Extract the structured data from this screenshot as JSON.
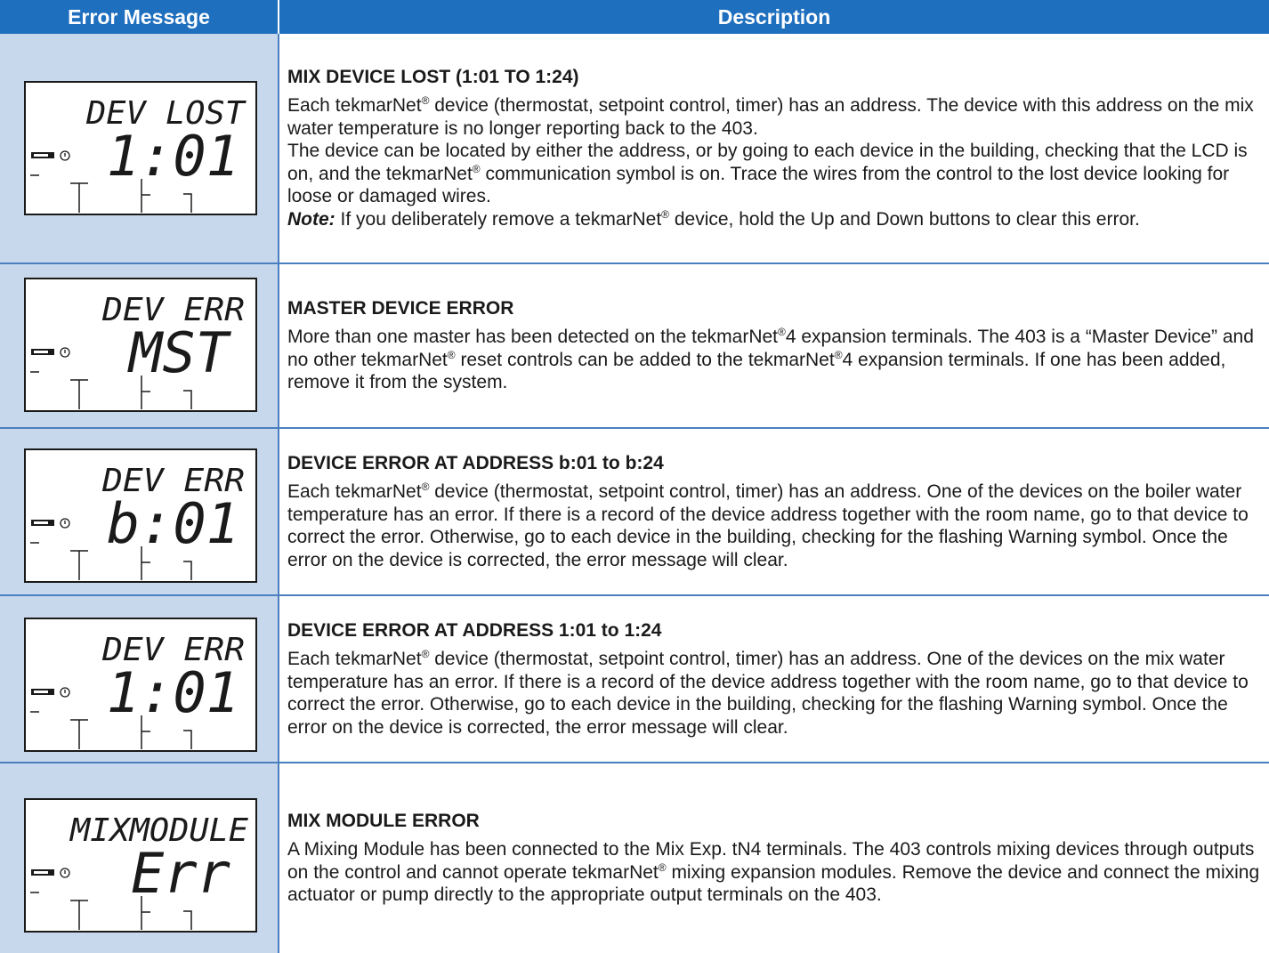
{
  "header": {
    "col1": "Error Message",
    "col2": "Description"
  },
  "colors": {
    "header_bg": "#1f6fbf",
    "lcd_cell_bg": "#c8d8ec",
    "border": "#4a7fbf"
  },
  "rows": [
    {
      "lcd": {
        "top_text": "DEV LOST",
        "main_text": "1:01",
        "icons": [
          "wrench-icon",
          "warning-icon"
        ]
      },
      "title": "MIX DEVICE LOST (1:01 TO 1:24)",
      "paragraphs": [
        "Each tekmarNet® device (thermostat, setpoint control, timer) has an address. The device with this address on the mix water temperature is no longer reporting back to the 403.",
        "The device can be located by either the address, or by going to each device in the building, checking that the LCD is on, and the tekmarNet® communication symbol is on. Trace the wires from the control to the lost device looking for loose or damaged wires."
      ],
      "note_label": "Note:",
      "note_text": " If you deliberately remove a tekmarNet® device, hold the Up and Down buttons to clear this error."
    },
    {
      "lcd": {
        "top_text": "DEV ERR",
        "main_text": "MST",
        "icons": [
          "wrench-icon",
          "warning-icon"
        ]
      },
      "title": "MASTER DEVICE ERROR",
      "paragraphs": [
        "More than one master has been detected on the tekmarNet®4 expansion terminals. The 403 is a “Master Device” and no other tekmarNet® reset controls can be added to the tekmarNet®4 expansion terminals. If one has been added, remove it from the system."
      ]
    },
    {
      "lcd": {
        "top_text": "DEV ERR",
        "main_text": "b:01",
        "icons": [
          "wrench-icon",
          "warning-icon"
        ]
      },
      "title": "DEVICE ERROR AT ADDRESS b:01 to b:24",
      "paragraphs": [
        "Each tekmarNet® device (thermostat, setpoint control, timer) has an address. One of the devices on the boiler water temperature has an error. If there is a record of the device address together with the room name, go to that device to correct the error. Otherwise, go to each device in the building, checking for the flashing Warning symbol. Once the error on the device is corrected, the error message will clear."
      ]
    },
    {
      "lcd": {
        "top_text": "DEV ERR",
        "main_text": "1:01",
        "icons": [
          "wrench-icon",
          "warning-icon"
        ]
      },
      "title": "DEVICE ERROR AT ADDRESS 1:01 to 1:24",
      "paragraphs": [
        "Each tekmarNet® device (thermostat, setpoint control, timer) has an address. One of the devices on the mix water temperature has an error. If there is a record of the device address together with the room name, go to that device to correct the error. Otherwise, go to each device in the building, checking for the flashing Warning symbol. Once the error on the device is corrected, the error message will clear."
      ]
    },
    {
      "lcd": {
        "top_text": "MIXMODULE",
        "main_text": "Err",
        "icons": [
          "wrench-icon",
          "warning-icon"
        ]
      },
      "title": "MIX MODULE ERROR",
      "paragraphs": [
        "A Mixing Module has been connected to the Mix Exp. tN4 terminals. The 403 controls mixing devices through outputs on the control and cannot operate tekmarNet® mixing expansion modules. Remove the device and connect the mixing actuator or pump directly to the appropriate output terminals on the 403."
      ]
    }
  ]
}
